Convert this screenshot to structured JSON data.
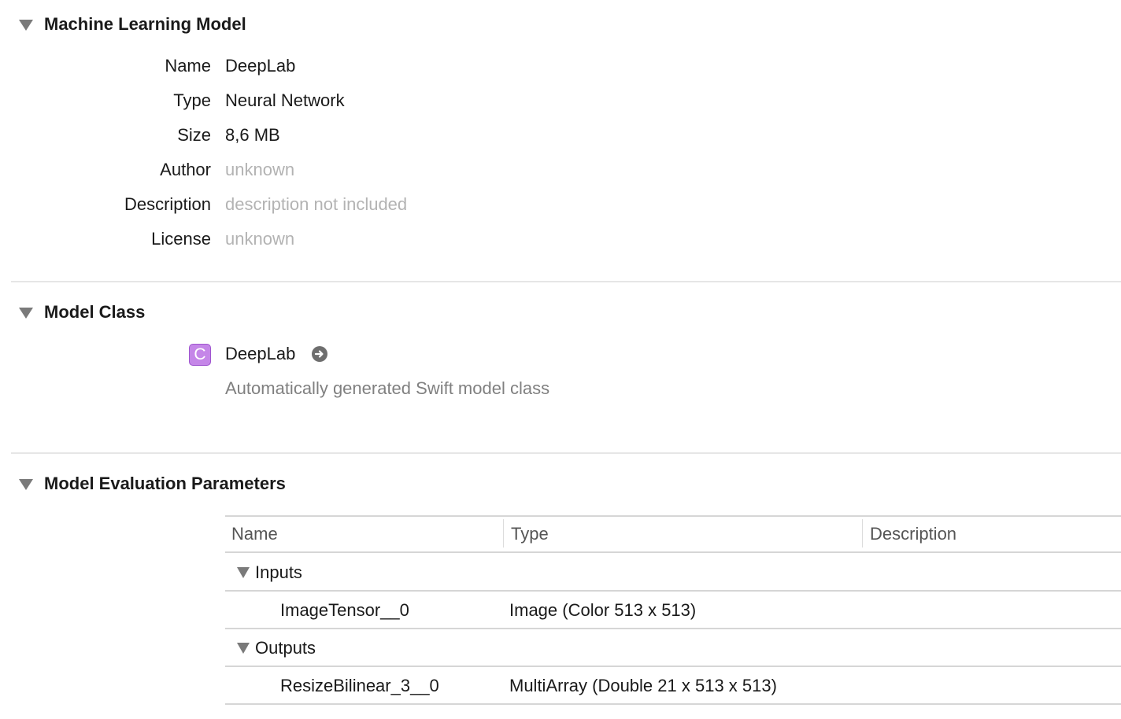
{
  "ml_model": {
    "title": "Machine Learning Model",
    "fields": [
      {
        "label": "Name",
        "value": "DeepLab"
      },
      {
        "label": "Type",
        "value": "Neural Network"
      },
      {
        "label": "Size",
        "value": "8,6 MB"
      },
      {
        "label": "Author",
        "value": "unknown"
      },
      {
        "label": "Description",
        "value": "description not included"
      },
      {
        "label": "License",
        "value": "unknown"
      }
    ]
  },
  "model_class": {
    "title": "Model Class",
    "badge": "C",
    "class_name": "DeepLab",
    "goto_icon": "arrow-right-circle-icon",
    "subtitle": "Automatically generated Swift model class"
  },
  "eval_params": {
    "title": "Model Evaluation Parameters",
    "columns": [
      "Name",
      "Type",
      "Description"
    ],
    "groups": [
      {
        "label": "Inputs",
        "rows": [
          {
            "name": "ImageTensor__0",
            "type": "Image (Color 513 x 513)",
            "description": ""
          }
        ]
      },
      {
        "label": "Outputs",
        "rows": [
          {
            "name": "ResizeBilinear_3__0",
            "type": "MultiArray (Double 21 x 513 x 513)",
            "description": ""
          }
        ]
      }
    ]
  },
  "colors": {
    "badge": "#c586e8",
    "muted_text": "#b3b3b3",
    "separator": "#e6e6e6"
  }
}
